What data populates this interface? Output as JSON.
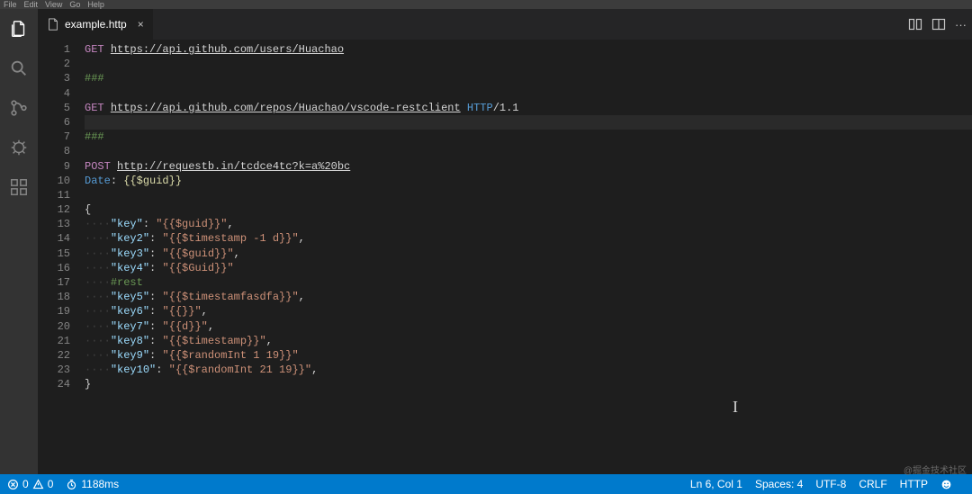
{
  "menubar": {
    "items": [
      "File",
      "Edit",
      "View",
      "Go",
      "Help"
    ]
  },
  "activitybar": {
    "items": [
      "files-icon",
      "search-icon",
      "scm-icon",
      "debug-icon",
      "extensions-icon"
    ]
  },
  "tab": {
    "filename": "example.http",
    "close": "×"
  },
  "tabactions": {
    "more": "···"
  },
  "editor": {
    "lines": [
      {
        "n": 1,
        "segs": [
          {
            "c": "tok-method",
            "t": "GET"
          },
          {
            "c": "",
            "t": " "
          },
          {
            "c": "tok-url",
            "t": "https://api.github.com/users/Huachao"
          }
        ]
      },
      {
        "n": 2,
        "segs": []
      },
      {
        "n": 3,
        "segs": [
          {
            "c": "tok-sep",
            "t": "###"
          }
        ]
      },
      {
        "n": 4,
        "segs": []
      },
      {
        "n": 5,
        "segs": [
          {
            "c": "tok-method",
            "t": "GET"
          },
          {
            "c": "",
            "t": " "
          },
          {
            "c": "tok-url",
            "t": "https://api.github.com/repos/Huachao/vscode-restclient"
          },
          {
            "c": "",
            "t": " "
          },
          {
            "c": "tok-http",
            "t": "HTTP"
          },
          {
            "c": "",
            "t": "/1.1"
          }
        ]
      },
      {
        "n": 6,
        "caret": true,
        "segs": []
      },
      {
        "n": 7,
        "segs": [
          {
            "c": "tok-sep",
            "t": "###"
          }
        ]
      },
      {
        "n": 8,
        "segs": []
      },
      {
        "n": 9,
        "segs": [
          {
            "c": "tok-method",
            "t": "POST"
          },
          {
            "c": "",
            "t": " "
          },
          {
            "c": "tok-url",
            "t": "http://requestb.in/tcdce4tc?k=a%20bc"
          }
        ]
      },
      {
        "n": 10,
        "segs": [
          {
            "c": "tok-hdr",
            "t": "Date"
          },
          {
            "c": "",
            "t": ": "
          },
          {
            "c": "tok-var",
            "t": "{{$guid}}"
          }
        ]
      },
      {
        "n": 11,
        "segs": []
      },
      {
        "n": 12,
        "segs": [
          {
            "c": "",
            "t": "{"
          }
        ]
      },
      {
        "n": 13,
        "segs": [
          {
            "c": "tok-ws",
            "t": "····"
          },
          {
            "c": "tok-key",
            "t": "\"key\""
          },
          {
            "c": "",
            "t": ": "
          },
          {
            "c": "tok-str",
            "t": "\"{{$guid}}\""
          },
          {
            "c": "",
            "t": ","
          }
        ]
      },
      {
        "n": 14,
        "segs": [
          {
            "c": "tok-ws",
            "t": "····"
          },
          {
            "c": "tok-key",
            "t": "\"key2\""
          },
          {
            "c": "",
            "t": ": "
          },
          {
            "c": "tok-str",
            "t": "\"{{$timestamp -1 d}}\""
          },
          {
            "c": "",
            "t": ","
          }
        ]
      },
      {
        "n": 15,
        "segs": [
          {
            "c": "tok-ws",
            "t": "····"
          },
          {
            "c": "tok-key",
            "t": "\"key3\""
          },
          {
            "c": "",
            "t": ": "
          },
          {
            "c": "tok-str",
            "t": "\"{{$guid}}\""
          },
          {
            "c": "",
            "t": ","
          }
        ]
      },
      {
        "n": 16,
        "segs": [
          {
            "c": "tok-ws",
            "t": "····"
          },
          {
            "c": "tok-key",
            "t": "\"key4\""
          },
          {
            "c": "",
            "t": ": "
          },
          {
            "c": "tok-str",
            "t": "\"{{$Guid}}\""
          }
        ]
      },
      {
        "n": 17,
        "segs": [
          {
            "c": "tok-ws",
            "t": "····"
          },
          {
            "c": "tok-comment",
            "t": "#rest"
          }
        ]
      },
      {
        "n": 18,
        "segs": [
          {
            "c": "tok-ws",
            "t": "····"
          },
          {
            "c": "tok-key",
            "t": "\"key5\""
          },
          {
            "c": "",
            "t": ": "
          },
          {
            "c": "tok-str",
            "t": "\"{{$timestamfasdfa}}\""
          },
          {
            "c": "",
            "t": ","
          }
        ]
      },
      {
        "n": 19,
        "segs": [
          {
            "c": "tok-ws",
            "t": "····"
          },
          {
            "c": "tok-key",
            "t": "\"key6\""
          },
          {
            "c": "",
            "t": ": "
          },
          {
            "c": "tok-str",
            "t": "\"{{}}\""
          },
          {
            "c": "",
            "t": ","
          }
        ]
      },
      {
        "n": 20,
        "segs": [
          {
            "c": "tok-ws",
            "t": "····"
          },
          {
            "c": "tok-key",
            "t": "\"key7\""
          },
          {
            "c": "",
            "t": ": "
          },
          {
            "c": "tok-str",
            "t": "\"{{d}}\""
          },
          {
            "c": "",
            "t": ","
          }
        ]
      },
      {
        "n": 21,
        "segs": [
          {
            "c": "tok-ws",
            "t": "····"
          },
          {
            "c": "tok-key",
            "t": "\"key8\""
          },
          {
            "c": "",
            "t": ": "
          },
          {
            "c": "tok-str",
            "t": "\"{{$timestamp}}\""
          },
          {
            "c": "",
            "t": ","
          }
        ]
      },
      {
        "n": 22,
        "segs": [
          {
            "c": "tok-ws",
            "t": "····"
          },
          {
            "c": "tok-key",
            "t": "\"key9\""
          },
          {
            "c": "",
            "t": ": "
          },
          {
            "c": "tok-str",
            "t": "\"{{$randomInt 1 19}}\""
          }
        ]
      },
      {
        "n": 23,
        "segs": [
          {
            "c": "tok-ws",
            "t": "····"
          },
          {
            "c": "tok-key",
            "t": "\"key10\""
          },
          {
            "c": "",
            "t": ": "
          },
          {
            "c": "tok-str",
            "t": "\"{{$randomInt 21 19}}\""
          },
          {
            "c": "",
            "t": ","
          }
        ]
      },
      {
        "n": 24,
        "segs": [
          {
            "c": "",
            "t": "}"
          }
        ]
      }
    ]
  },
  "watermark": "@掘金技术社区",
  "status": {
    "errors": "0",
    "warnings": "0",
    "timing": "1188ms",
    "cursor": "Ln 6, Col 1",
    "spaces": "Spaces: 4",
    "encoding": "UTF-8",
    "eol": "CRLF",
    "language": "HTTP"
  }
}
